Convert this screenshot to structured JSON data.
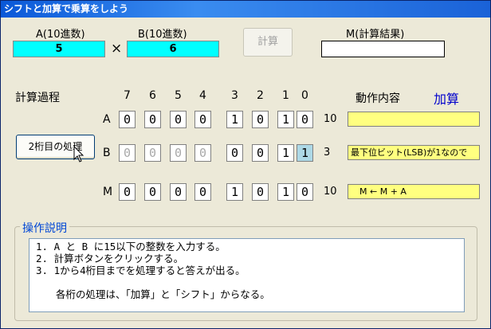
{
  "window": {
    "title": "シフトと加算で乗算をしよう"
  },
  "inputs": {
    "a_label": "A(10進数)",
    "a_value": "5",
    "times": "×",
    "b_label": "B(10進数)",
    "b_value": "6",
    "calc_button": "計算",
    "m_label": "M(計算結果)",
    "m_value": ""
  },
  "process": {
    "title": "計算過程",
    "step_button": "2桁目の処理",
    "bit_headers": [
      "7",
      "6",
      "5",
      "4",
      "3",
      "2",
      "1",
      "0"
    ],
    "action_header": "動作内容",
    "action_mode": "加算",
    "rows": [
      {
        "label": "A",
        "bits": [
          "0",
          "0",
          "0",
          "0",
          "1",
          "0",
          "1",
          "0"
        ],
        "decimal": "10",
        "action": ""
      },
      {
        "label": "B",
        "bits": [
          "0",
          "0",
          "0",
          "0",
          "0",
          "0",
          "1",
          "1"
        ],
        "decimal": "3",
        "action": "最下位ビット(LSB)が1なので"
      },
      {
        "label": "M",
        "bits": [
          "0",
          "0",
          "0",
          "0",
          "1",
          "0",
          "1",
          "0"
        ],
        "decimal": "10",
        "action": "M ← M + A"
      }
    ]
  },
  "instructions": {
    "title": "操作説明",
    "lines": [
      "1. A と B に15以下の整数を入力する。",
      "2. 計算ボタンをクリックする。",
      "3. 1から4桁目までを処理すると答えが出る。",
      "",
      "　　各桁の処理は、「加算」と「シフト」からなる。"
    ]
  },
  "colors": {
    "input_bg": "#00ffff",
    "action_bg": "#ffff80",
    "mode_text": "#0000cc",
    "highlight_bit": "#add8e6"
  }
}
